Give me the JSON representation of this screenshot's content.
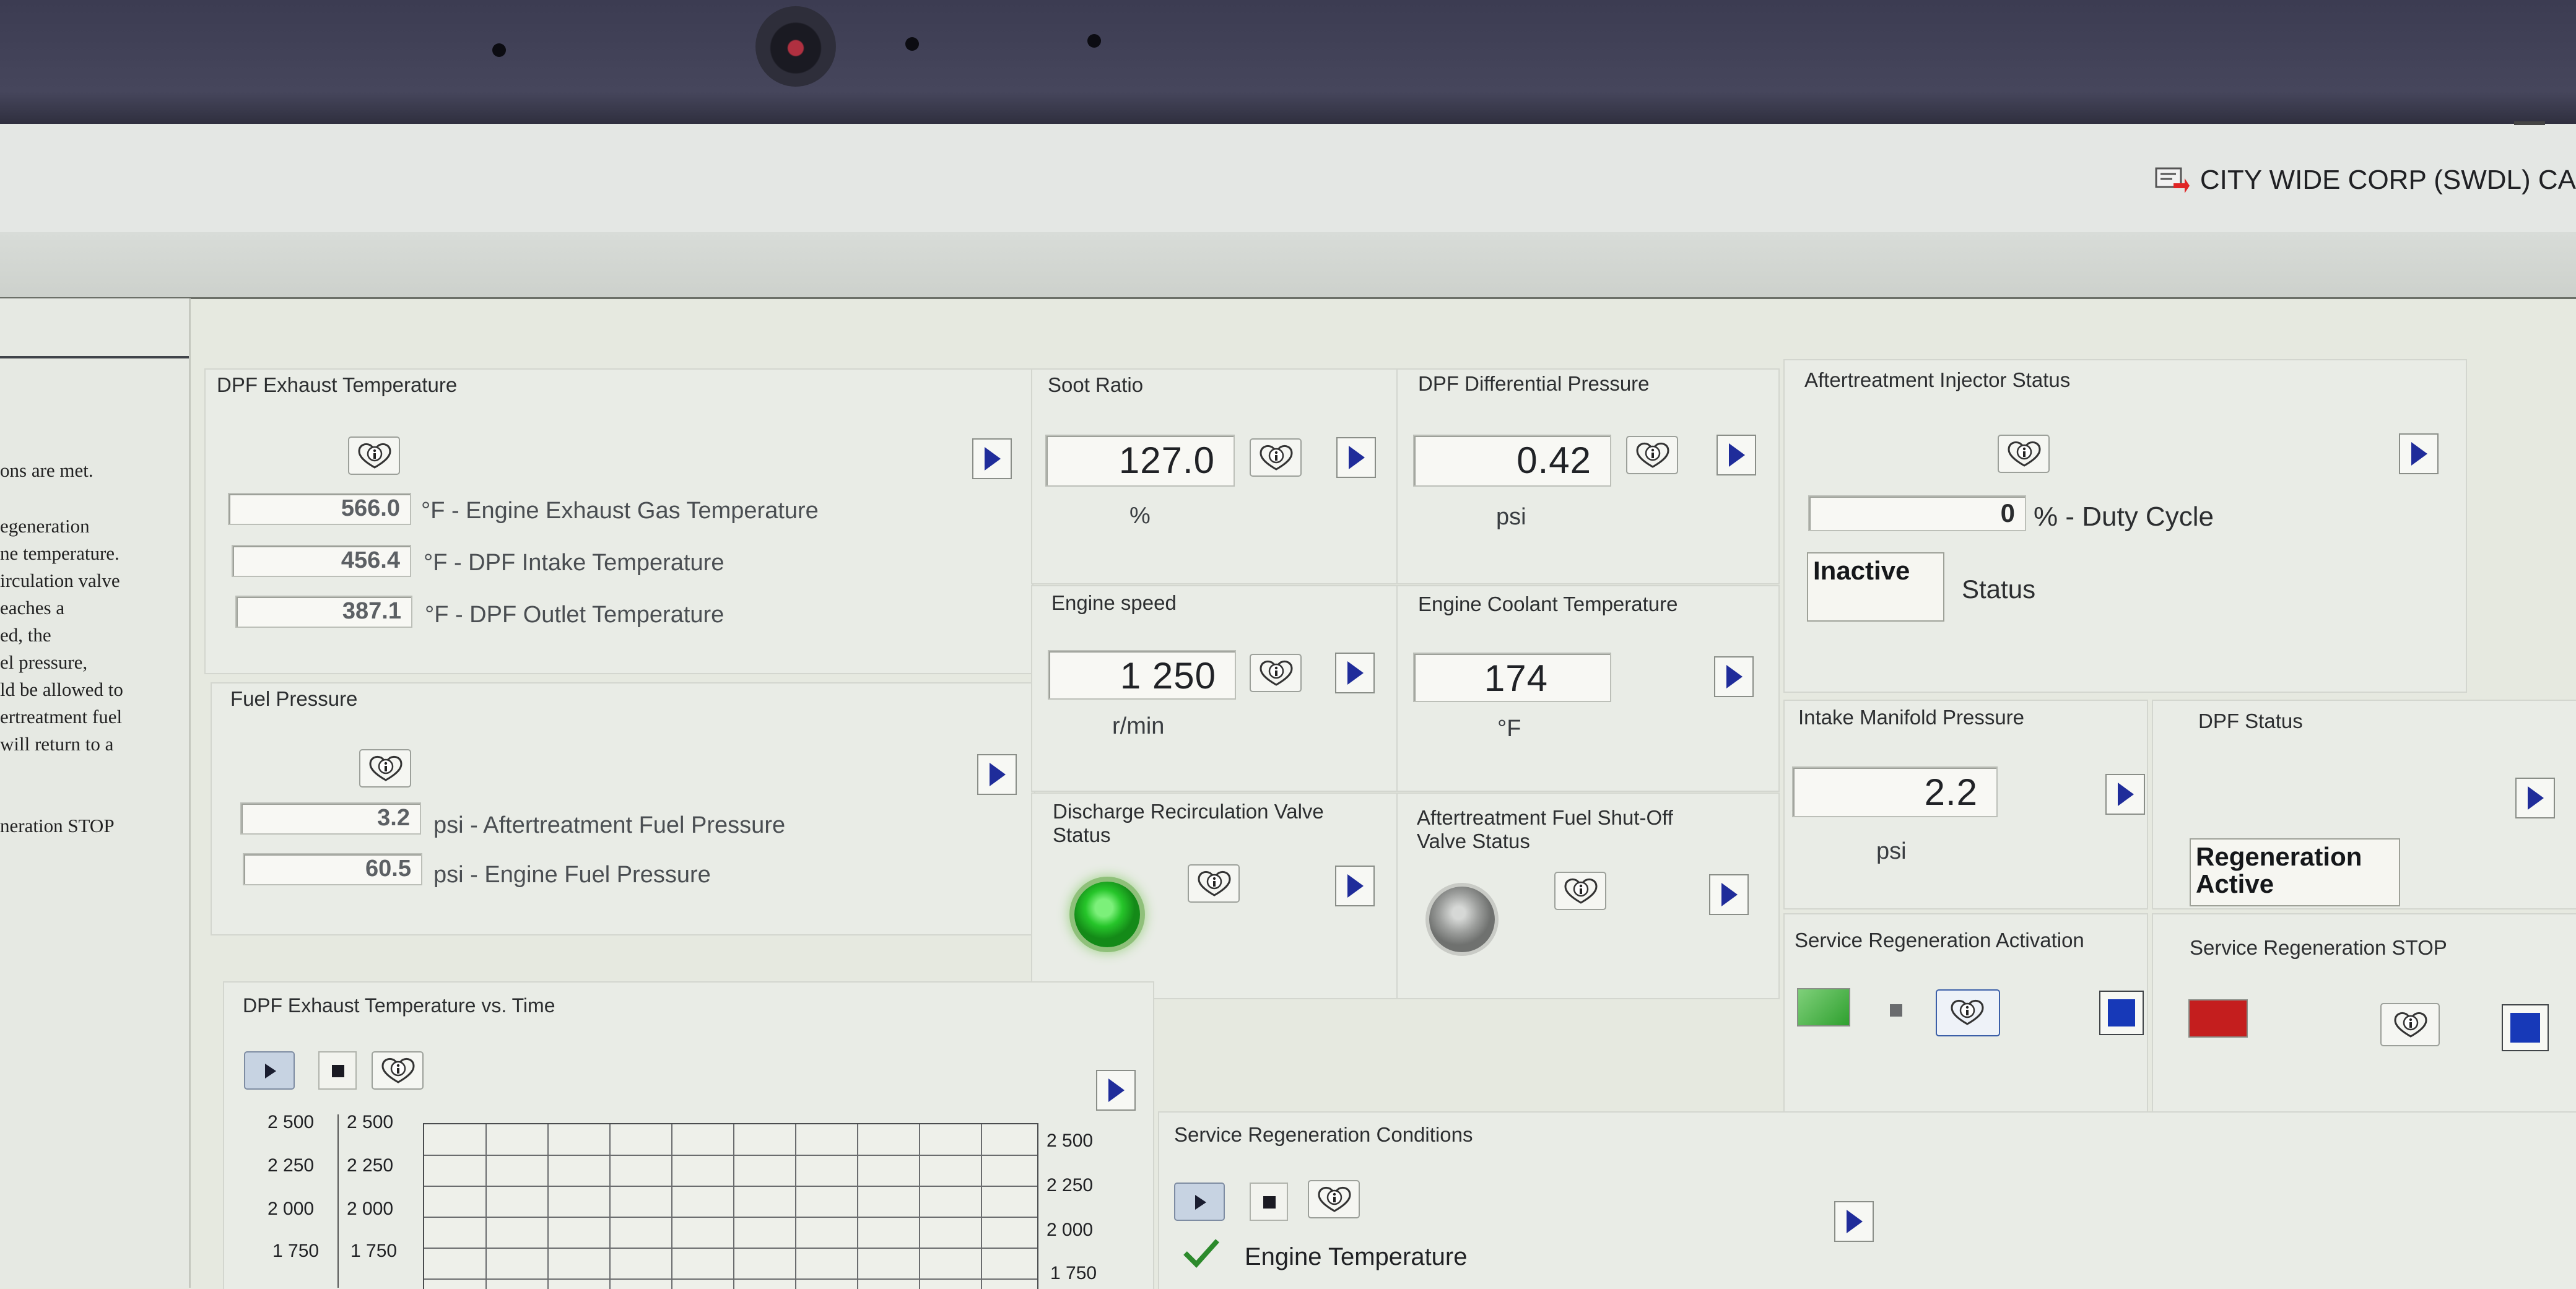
{
  "header": {
    "account": "CITY WIDE CORP (SWDL) CA"
  },
  "left_pane": {
    "lines": [
      "ons are met.",
      "egeneration",
      "ne temperature.",
      "irculation valve",
      "eaches a",
      "ed, the",
      "el pressure,",
      "ld be allowed to",
      "ertreatment fuel",
      "will return to a",
      "neration STOP"
    ]
  },
  "dpf_exhaust_temp": {
    "title": "DPF Exhaust Temperature",
    "rows": [
      {
        "value": "566.0",
        "label": "°F - Engine Exhaust Gas Temperature"
      },
      {
        "value": "456.4",
        "label": "°F - DPF Intake Temperature"
      },
      {
        "value": "387.1",
        "label": "°F - DPF Outlet Temperature"
      }
    ]
  },
  "fuel_pressure": {
    "title": "Fuel Pressure",
    "rows": [
      {
        "value": "3.2",
        "label": "psi - Aftertreatment Fuel Pressure"
      },
      {
        "value": "60.5",
        "label": "psi - Engine Fuel Pressure"
      }
    ]
  },
  "soot_ratio": {
    "title": "Soot Ratio",
    "value": "127.0",
    "unit": "%"
  },
  "dpf_diff_pressure": {
    "title": "DPF Differential Pressure",
    "value": "0.42",
    "unit": "psi"
  },
  "engine_speed": {
    "title": "Engine speed",
    "value": "1 250",
    "unit": "r/min"
  },
  "engine_coolant": {
    "title": "Engine Coolant Temperature",
    "value": "174",
    "unit": "°F"
  },
  "discharge_valve": {
    "title": "Discharge Recirculation Valve Status",
    "led_color": "#26c52a"
  },
  "fuel_shutoff": {
    "title": "Aftertreatment Fuel Shut-Off Valve Status",
    "led_color": "#9c9e9c"
  },
  "injector_status": {
    "title": "Aftertreatment Injector Status",
    "value": "0",
    "value_label": "% - Duty Cycle",
    "status": "Inactive",
    "status_label": "Status"
  },
  "intake_manifold": {
    "title": "Intake Manifold Pressure",
    "value": "2.2",
    "unit": "psi"
  },
  "dpf_status": {
    "title": "DPF Status",
    "status": "Regeneration Active"
  },
  "service_regen_activation": {
    "title": "Service Regeneration Activation",
    "indicator_color": "#2fa02f"
  },
  "service_regen_stop": {
    "title": "Service Regeneration STOP",
    "indicator_color": "#c41e1e"
  },
  "temp_chart": {
    "title": "DPF Exhaust Temperature vs. Time",
    "left_ticks": [
      "2 500",
      "2 250",
      "2 000",
      "1 750"
    ],
    "mid_ticks": [
      "2 500",
      "2 250",
      "2 000",
      "1 750"
    ],
    "right_ticks": [
      "2 500",
      "2 250",
      "2 000",
      "1 750"
    ]
  },
  "service_regen_conditions": {
    "title": "Service Regeneration Conditions",
    "items": [
      {
        "label": "Engine Temperature",
        "met": true
      }
    ]
  },
  "colors": {
    "menu_arrow": "#1f2c9a",
    "check": "#2c8a2c"
  }
}
